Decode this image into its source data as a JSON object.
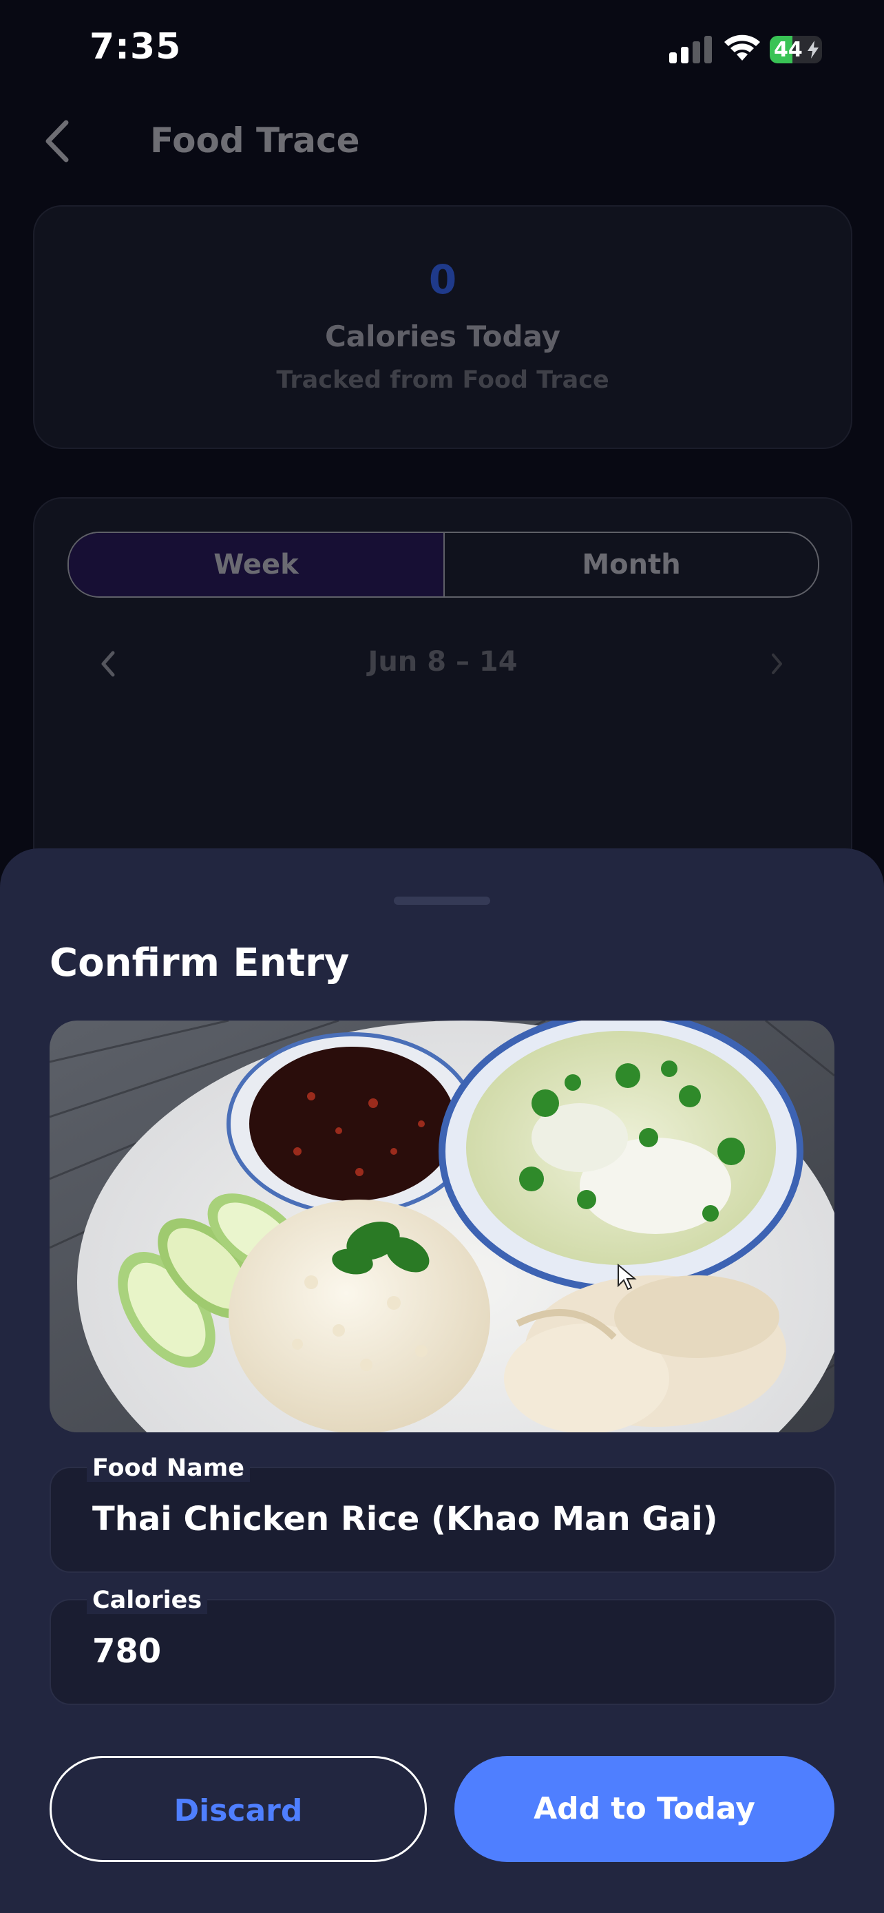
{
  "status_bar": {
    "time": "7:35",
    "battery_percent": "44",
    "battery_level": 0.44,
    "signal_bars_active": 2,
    "signal_bars_total": 4
  },
  "header": {
    "title": "Food Trace"
  },
  "summary": {
    "calories_value": "0",
    "calories_label": "Calories Today",
    "calories_source": "Tracked from Food Trace"
  },
  "range": {
    "tabs": [
      "Week",
      "Month"
    ],
    "selected_tab": "Week",
    "date_range": "Jun 8 – 14"
  },
  "sheet": {
    "title": "Confirm Entry",
    "photo_icon": "food-photo",
    "food_name_label": "Food Name",
    "food_name_value": "Thai Chicken Rice (Khao Man Gai)",
    "calories_label": "Calories",
    "calories_value": "780",
    "discard_label": "Discard",
    "add_label": "Add to Today"
  },
  "colors": {
    "accent": "#4f7fff",
    "sheet_bg": "#222640",
    "battery_green": "#39c355"
  }
}
